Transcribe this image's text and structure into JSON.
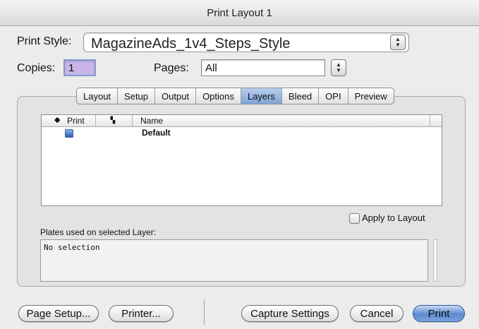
{
  "window": {
    "title": "Print Layout 1"
  },
  "print_style": {
    "label": "Print Style:",
    "value": "MagazineAds_1v4_Steps_Style"
  },
  "copies": {
    "label": "Copies:",
    "value": "1"
  },
  "pages": {
    "label": "Pages:",
    "value": "All"
  },
  "tabs": [
    {
      "label": "Layout",
      "active": false
    },
    {
      "label": "Setup",
      "active": false
    },
    {
      "label": "Output",
      "active": false
    },
    {
      "label": "Options",
      "active": false
    },
    {
      "label": "Layers",
      "active": true
    },
    {
      "label": "Bleed",
      "active": false
    },
    {
      "label": "OPI",
      "active": false
    },
    {
      "label": "Preview",
      "active": false
    }
  ],
  "layers_table": {
    "columns": {
      "print": "Print",
      "name": "Name"
    },
    "rows": [
      {
        "print": true,
        "name": "Default"
      }
    ]
  },
  "apply_to_layout": {
    "label": "Apply to Layout",
    "checked": false
  },
  "plates": {
    "label": "Plates used on selected Layer:",
    "value": "No selection"
  },
  "buttons": {
    "page_setup": "Page Setup...",
    "printer": "Printer...",
    "capture_settings": "Capture Settings",
    "cancel": "Cancel",
    "print": "Print"
  },
  "colors": {
    "default_button": "#5b8ad0",
    "active_tab": "#7fa3d7"
  }
}
